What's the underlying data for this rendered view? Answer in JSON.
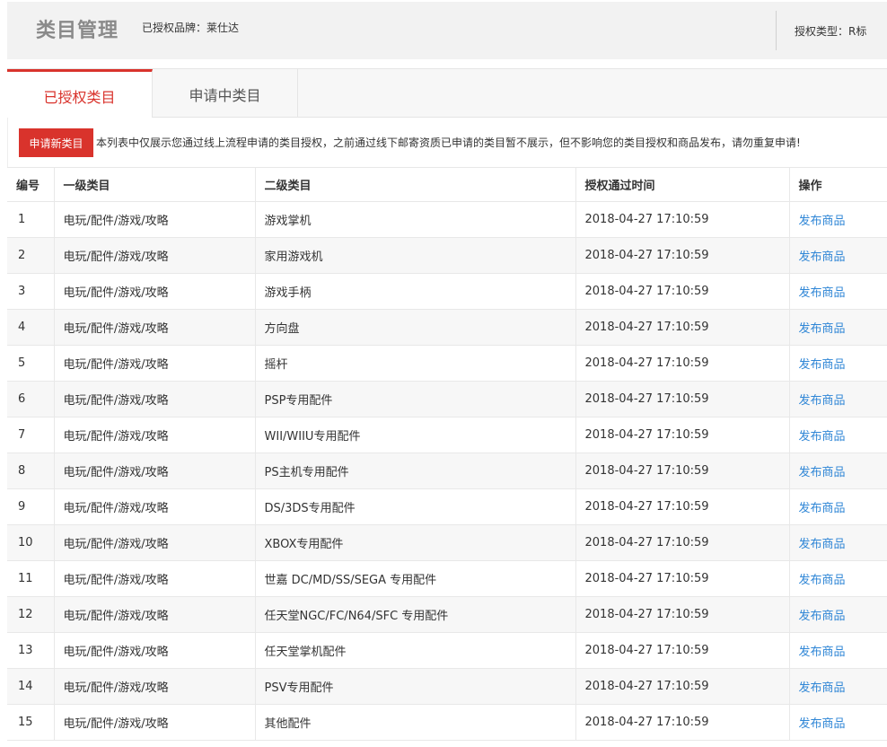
{
  "header": {
    "title": "类目管理",
    "brand": "已授权品牌：莱仕达",
    "auth_type": "授权类型：R标"
  },
  "tabs": [
    {
      "label": "已授权类目",
      "active": true
    },
    {
      "label": "申请中类目",
      "active": false
    }
  ],
  "notice": {
    "apply_button": "申请新类目",
    "text": "本列表中仅展示您通过线上流程申请的类目授权，之前通过线下邮寄资质已申请的类目暂不展示，但不影响您的类目授权和商品发布，请勿重复申请!"
  },
  "table": {
    "columns": [
      "编号",
      "一级类目",
      "二级类目",
      "授权通过时间",
      "操作"
    ],
    "rows": [
      {
        "num": "1",
        "level1": "电玩/配件/游戏/攻略",
        "level2": "游戏掌机",
        "time": "2018-04-27 17:10:59",
        "action": "发布商品"
      },
      {
        "num": "2",
        "level1": "电玩/配件/游戏/攻略",
        "level2": "家用游戏机",
        "time": "2018-04-27 17:10:59",
        "action": "发布商品"
      },
      {
        "num": "3",
        "level1": "电玩/配件/游戏/攻略",
        "level2": "游戏手柄",
        "time": "2018-04-27 17:10:59",
        "action": "发布商品"
      },
      {
        "num": "4",
        "level1": "电玩/配件/游戏/攻略",
        "level2": "方向盘",
        "time": "2018-04-27 17:10:59",
        "action": "发布商品"
      },
      {
        "num": "5",
        "level1": "电玩/配件/游戏/攻略",
        "level2": "摇杆",
        "time": "2018-04-27 17:10:59",
        "action": "发布商品"
      },
      {
        "num": "6",
        "level1": "电玩/配件/游戏/攻略",
        "level2": "PSP专用配件",
        "time": "2018-04-27 17:10:59",
        "action": "发布商品"
      },
      {
        "num": "7",
        "level1": "电玩/配件/游戏/攻略",
        "level2": "WII/WIIU专用配件",
        "time": "2018-04-27 17:10:59",
        "action": "发布商品"
      },
      {
        "num": "8",
        "level1": "电玩/配件/游戏/攻略",
        "level2": "PS主机专用配件",
        "time": "2018-04-27 17:10:59",
        "action": "发布商品"
      },
      {
        "num": "9",
        "level1": "电玩/配件/游戏/攻略",
        "level2": "DS/3DS专用配件",
        "time": "2018-04-27 17:10:59",
        "action": "发布商品"
      },
      {
        "num": "10",
        "level1": "电玩/配件/游戏/攻略",
        "level2": "XBOX专用配件",
        "time": "2018-04-27 17:10:59",
        "action": "发布商品"
      },
      {
        "num": "11",
        "level1": "电玩/配件/游戏/攻略",
        "level2": "世嘉 DC/MD/SS/SEGA 专用配件",
        "time": "2018-04-27 17:10:59",
        "action": "发布商品"
      },
      {
        "num": "12",
        "level1": "电玩/配件/游戏/攻略",
        "level2": "任天堂NGC/FC/N64/SFC 专用配件",
        "time": "2018-04-27 17:10:59",
        "action": "发布商品"
      },
      {
        "num": "13",
        "level1": "电玩/配件/游戏/攻略",
        "level2": "任天堂掌机配件",
        "time": "2018-04-27 17:10:59",
        "action": "发布商品"
      },
      {
        "num": "14",
        "level1": "电玩/配件/游戏/攻略",
        "level2": "PSV专用配件",
        "time": "2018-04-27 17:10:59",
        "action": "发布商品"
      },
      {
        "num": "15",
        "level1": "电玩/配件/游戏/攻略",
        "level2": "其他配件",
        "time": "2018-04-27 17:10:59",
        "action": "发布商品"
      }
    ]
  },
  "colors": {
    "accent": "#d9332c",
    "link": "#2f86d6"
  }
}
